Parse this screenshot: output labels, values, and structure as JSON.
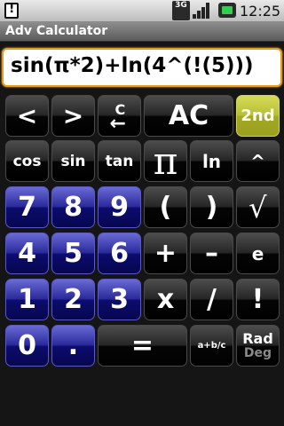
{
  "status_bar": {
    "network": "3G",
    "time": "12:25"
  },
  "app": {
    "title": "Adv Calculator"
  },
  "display": {
    "expression": "sin(π*2)+ln(4^(!(5)))"
  },
  "keys": {
    "left": "<",
    "right": ">",
    "clear_char": "C",
    "all_clear": "AC",
    "second": "2nd",
    "cos": "cos",
    "sin": "sin",
    "tan": "tan",
    "pi": "π",
    "ln": "ln",
    "power": "^",
    "d7": "7",
    "d8": "8",
    "d9": "9",
    "lparen": "(",
    "rparen": ")",
    "sqrt": "√",
    "d4": "4",
    "d5": "5",
    "d6": "6",
    "plus": "+",
    "minus": "–",
    "e": "e",
    "d1": "1",
    "d2": "2",
    "d3": "3",
    "times": "x",
    "divide": "/",
    "factorial": "!",
    "d0": "0",
    "dot": ".",
    "equals": "=",
    "fraction": "a+b/c",
    "rad": "Rad",
    "deg": "Deg"
  },
  "colors": {
    "display_border": "#e99a18",
    "digit_key": "#1a1a8a",
    "second_key": "#b9c031",
    "function_key": "#1a1a1a"
  }
}
